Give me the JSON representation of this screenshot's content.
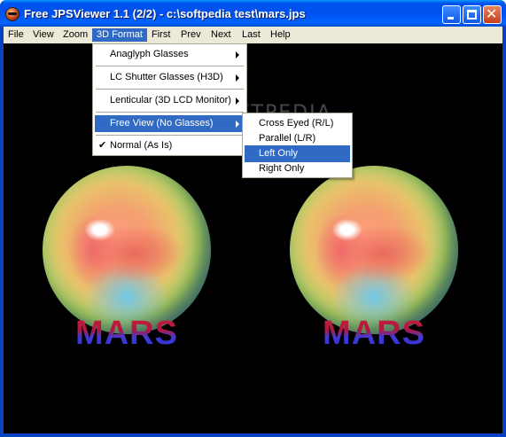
{
  "window": {
    "title": "Free JPSViewer 1.1 (2/2) - c:\\softpedia test\\mars.jps",
    "controls": {
      "close_glyph": "✕"
    }
  },
  "menubar": {
    "items": [
      "File",
      "View",
      "Zoom",
      "3D Format",
      "First",
      "Prev",
      "Next",
      "Last",
      "Help"
    ],
    "active": "3D Format"
  },
  "menu_3d_format": {
    "items": [
      "Anaglyph Glasses",
      "LC Shutter Glasses (H3D)",
      "Lenticular (3D LCD Monitor)",
      "Free View (No Glasses)",
      "Normal (As Is)"
    ],
    "highlighted": "Free View (No Glasses)",
    "checked": "Normal (As Is)",
    "check_glyph": "✔"
  },
  "submenu_free_view": {
    "items": [
      "Cross Eyed (R/L)",
      "Parallel (L/R)",
      "Left Only",
      "Right Only"
    ],
    "highlighted": "Left Only"
  },
  "image": {
    "caption_left": "MARS",
    "caption_right": "MARS",
    "watermark": "SOFTPEDIA"
  },
  "colors": {
    "title_bar": "#0054e3",
    "menu_highlight": "#316ac5",
    "viewer_background": "#000000"
  }
}
